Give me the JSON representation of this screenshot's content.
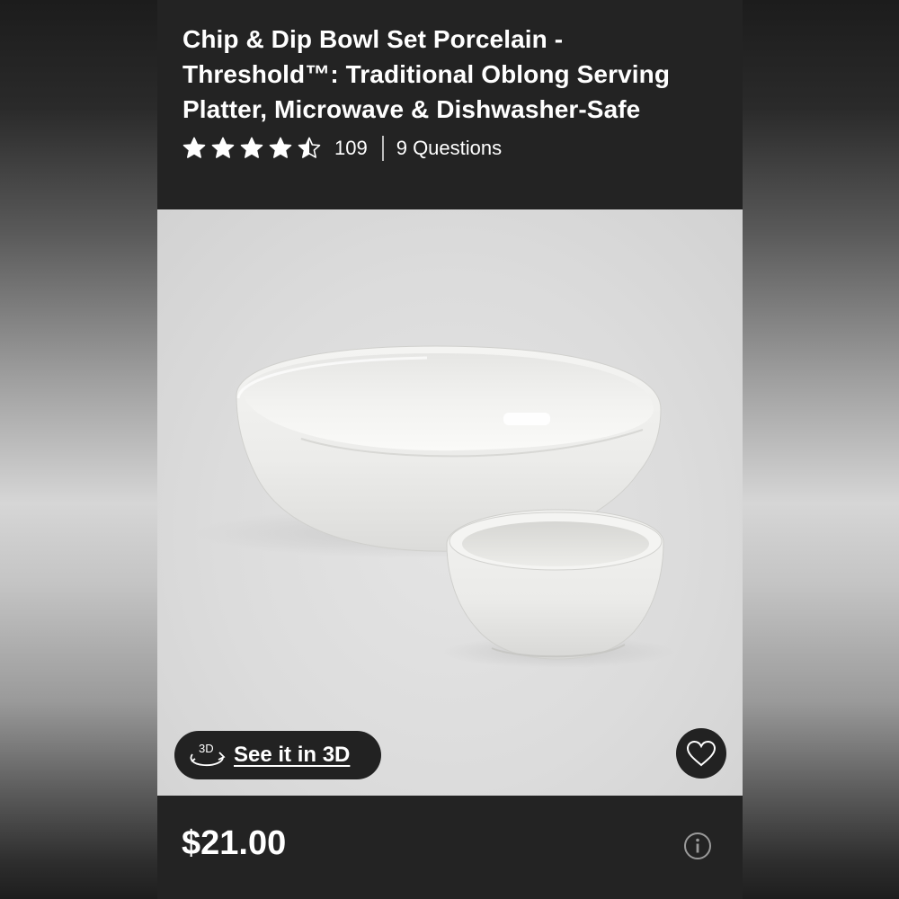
{
  "product": {
    "title": "Chip & Dip Bowl Set Porcelain - Threshold™: Traditional Oblong Serving Platter, Microwave & Dishwasher-Safe",
    "rating": {
      "stars": 4.5,
      "max_stars": 5,
      "review_count": "109",
      "questions_label": "9 Questions"
    },
    "image": {
      "subject": "white oval porcelain serving bowl with small round white dip bowl"
    },
    "view_3d": {
      "icon_label": "3D",
      "label": "See it in 3D"
    },
    "favorite": {
      "icon": "heart-outline-icon"
    },
    "price": "$21.00",
    "info": {
      "icon": "info-icon"
    }
  },
  "colors": {
    "panel_background": "#232323",
    "image_background": "#dcdcdc",
    "text": "#ffffff"
  }
}
